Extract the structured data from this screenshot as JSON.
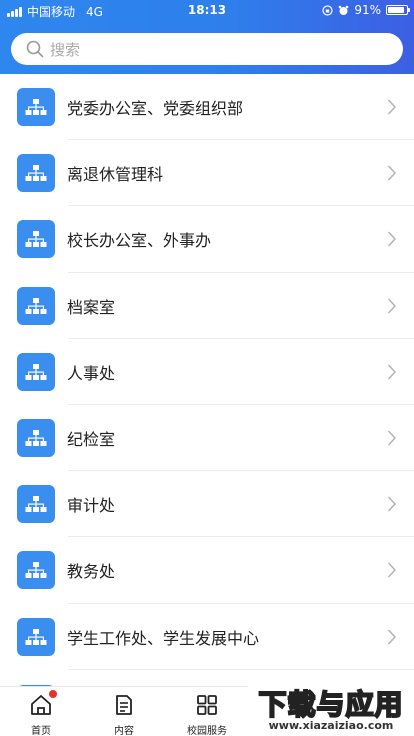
{
  "status_bar": {
    "carrier": "中国移动",
    "network": "4G",
    "time": "18:13",
    "battery": "91%",
    "battery_level": 0.91
  },
  "search": {
    "placeholder": "搜索"
  },
  "departments": [
    {
      "label": "党委办公室、党委组织部",
      "icon": "org-chart-icon"
    },
    {
      "label": "离退休管理科",
      "icon": "org-chart-icon"
    },
    {
      "label": "校长办公室、外事办",
      "icon": "org-chart-icon"
    },
    {
      "label": "档案室",
      "icon": "org-chart-icon"
    },
    {
      "label": "人事处",
      "icon": "org-chart-icon"
    },
    {
      "label": "纪检室",
      "icon": "org-chart-icon"
    },
    {
      "label": "审计处",
      "icon": "org-chart-icon"
    },
    {
      "label": "教务处",
      "icon": "org-chart-icon"
    },
    {
      "label": "学生工作处、学生发展中心",
      "icon": "org-chart-icon"
    }
  ],
  "tabbar": {
    "home": "首页",
    "content": "内容",
    "campus": "校园服务"
  },
  "watermark": {
    "main": "下载与应用",
    "url": "www.xiazaiziao.com"
  },
  "colors": {
    "header_start": "#2f86ee",
    "header_end": "#3d5fe3",
    "icon_bg": "#3a8ef0",
    "badge": "#e8312f"
  }
}
